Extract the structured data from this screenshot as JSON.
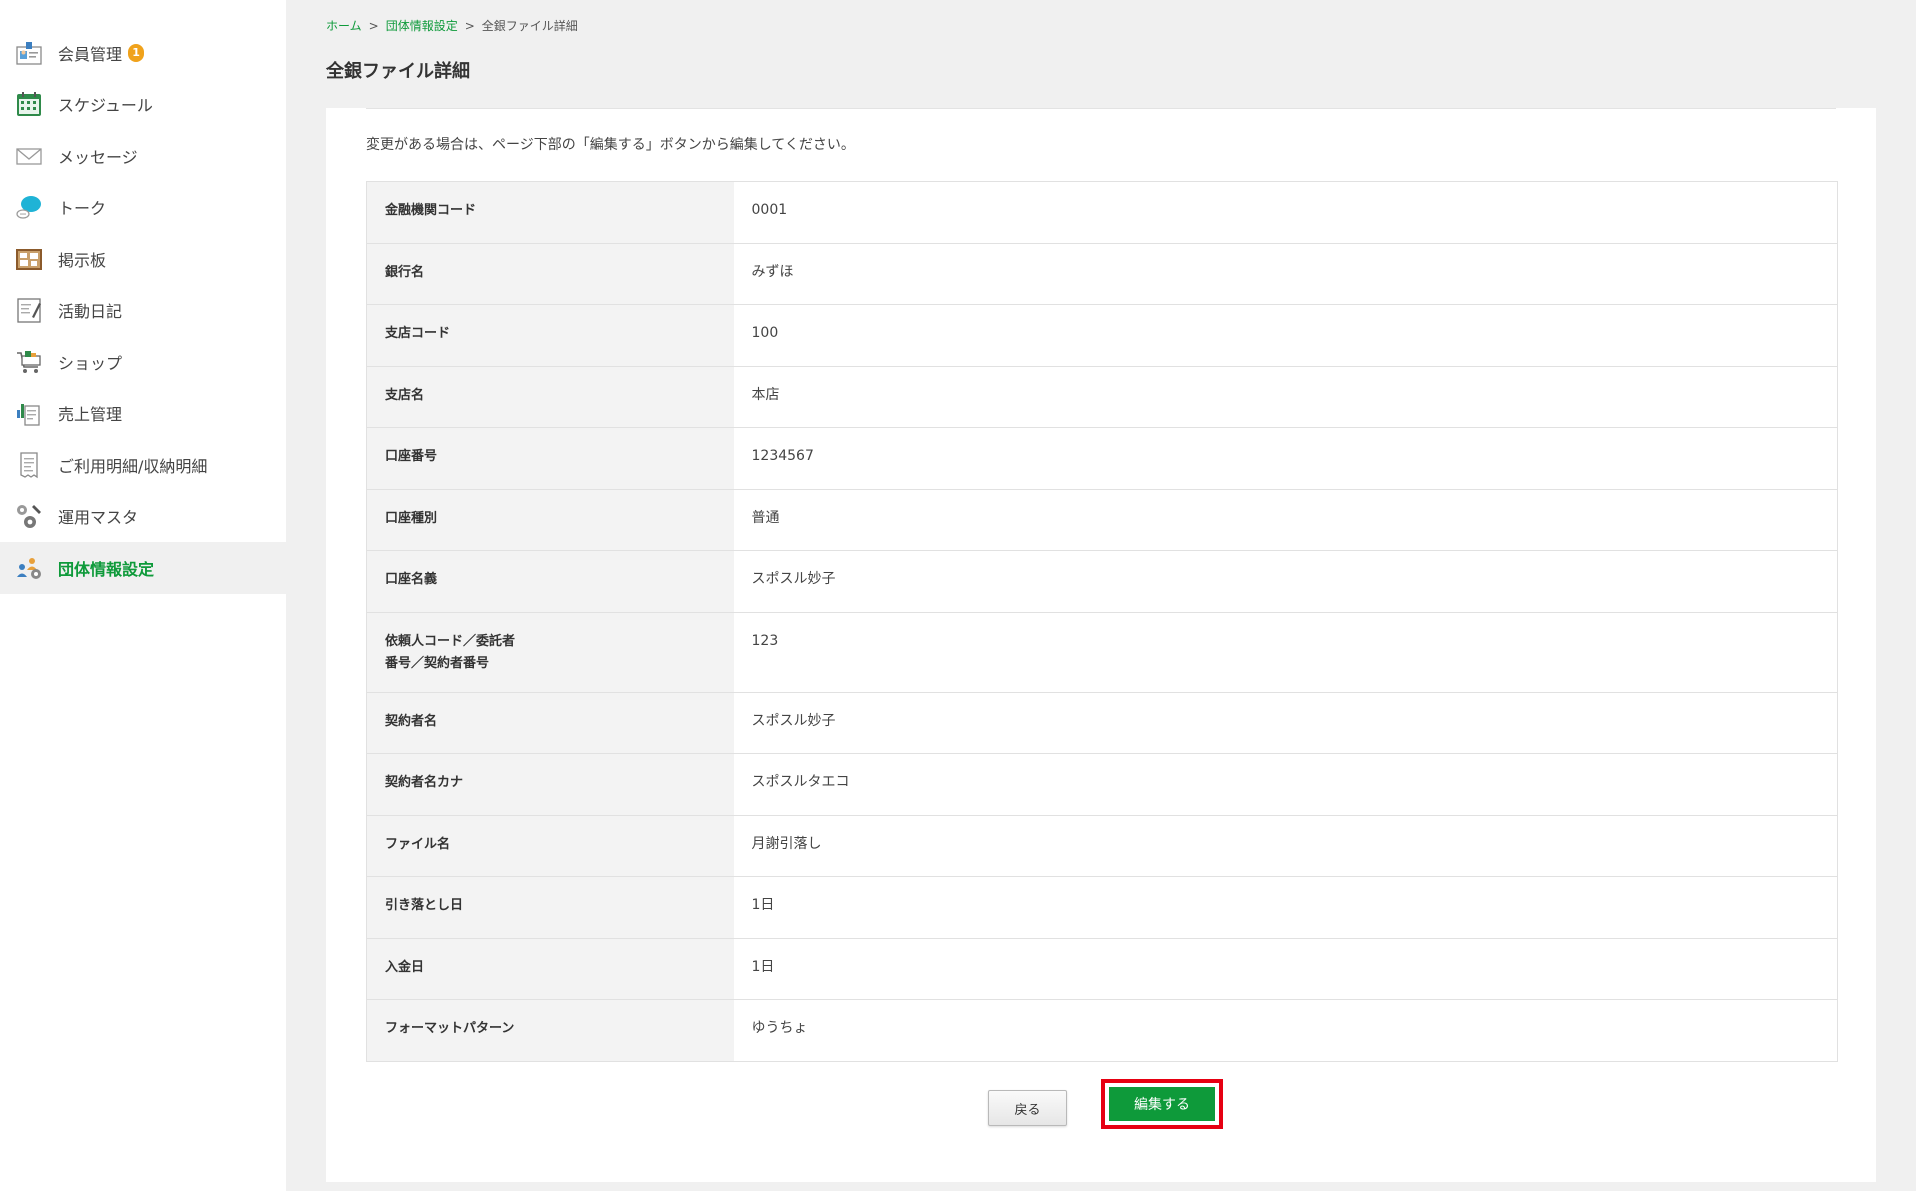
{
  "sidebar": {
    "items": [
      {
        "label": "会員管理",
        "icon": "member-card-icon",
        "badge": "1"
      },
      {
        "label": "スケジュール",
        "icon": "calendar-icon"
      },
      {
        "label": "メッセージ",
        "icon": "envelope-icon"
      },
      {
        "label": "トーク",
        "icon": "chat-bubble-icon"
      },
      {
        "label": "掲示板",
        "icon": "bulletin-board-icon"
      },
      {
        "label": "活動日記",
        "icon": "notebook-pen-icon"
      },
      {
        "label": "ショップ",
        "icon": "shopping-cart-icon"
      },
      {
        "label": "売上管理",
        "icon": "sales-chart-icon"
      },
      {
        "label": "ご利用明細/収納明細",
        "icon": "receipt-icon"
      },
      {
        "label": "運用マスタ",
        "icon": "gear-wrench-icon"
      },
      {
        "label": "団体情報設定",
        "icon": "group-settings-icon",
        "active": true
      }
    ]
  },
  "breadcrumb": {
    "home": "ホーム",
    "parent": "団体情報設定",
    "current": "全銀ファイル詳細",
    "separator": ">"
  },
  "page_title": "全銀ファイル詳細",
  "notice": "変更がある場合は、ページ下部の「編集する」ボタンから編集してください。",
  "details": {
    "rows": [
      {
        "label": "金融機関コード",
        "value": "0001"
      },
      {
        "label": "銀行名",
        "value": "みずほ"
      },
      {
        "label": "支店コード",
        "value": "100"
      },
      {
        "label": "支店名",
        "value": "本店"
      },
      {
        "label": "口座番号",
        "value": "1234567"
      },
      {
        "label": "口座種別",
        "value": "普通"
      },
      {
        "label": "口座名義",
        "value": "スポスル妙子"
      },
      {
        "label": "依頼人コード／委託者",
        "label2": "番号／契約者番号",
        "value": "123"
      },
      {
        "label": "契約者名",
        "value": "スポスル妙子"
      },
      {
        "label": "契約者名カナ",
        "value": "スポスルタエコ"
      },
      {
        "label": "ファイル名",
        "value": "月謝引落し"
      },
      {
        "label": "引き落とし日",
        "value": "1日"
      },
      {
        "label": "入金日",
        "value": "1日"
      },
      {
        "label": "フォーマットパターン",
        "value": "ゆうちょ"
      }
    ]
  },
  "buttons": {
    "back": "戻る",
    "edit": "編集する"
  },
  "colors": {
    "accent": "#0e9a3a",
    "badge": "#f0a21b",
    "highlight": "#e60012"
  }
}
